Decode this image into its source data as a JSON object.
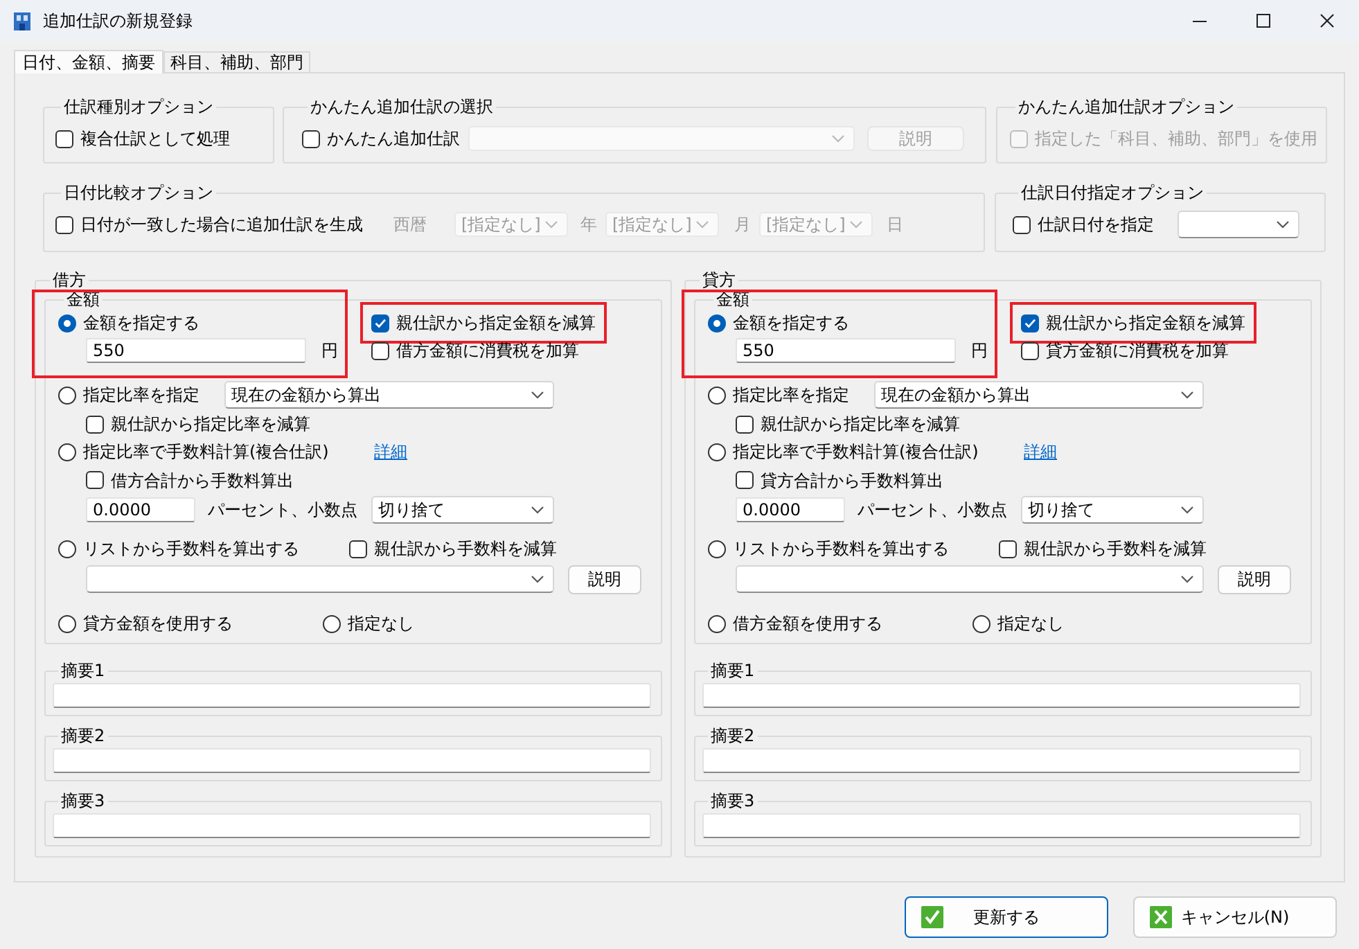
{
  "window": {
    "title": "追加仕訳の新規登録"
  },
  "tabs": [
    {
      "label": "日付、金額、摘要",
      "selected": true
    },
    {
      "label": "科目、補助、部門",
      "selected": false
    }
  ],
  "entry_type_option": {
    "title": "仕訳種別オプション",
    "compound": {
      "label": "複合仕訳として処理",
      "checked": false
    }
  },
  "simple_entry_selection": {
    "title": "かんたん追加仕訳の選択",
    "enable": {
      "label": "かんたん追加仕訳",
      "checked": false
    },
    "dropdown": {
      "disabled": true
    },
    "button": {
      "label": "説明",
      "disabled": true
    }
  },
  "simple_entry_option": {
    "title": "かんたん追加仕訳オプション",
    "use_accounts": {
      "label": "指定した「科目、補助、部門」を使用",
      "checked": false,
      "disabled": true
    }
  },
  "date_compare_option": {
    "title": "日付比較オプション",
    "generate": {
      "label": "日付が一致した場合に追加仕訳を生成",
      "checked": false
    },
    "fields": [
      {
        "kind": "label",
        "text": "西暦",
        "disabled": true
      },
      {
        "kind": "select",
        "value": "[指定なし]",
        "disabled": true
      },
      {
        "kind": "label",
        "text": "年",
        "disabled": true
      },
      {
        "kind": "select",
        "value": "[指定なし]",
        "disabled": true
      },
      {
        "kind": "label",
        "text": "月",
        "disabled": true
      },
      {
        "kind": "select",
        "value": "[指定なし]",
        "disabled": true
      },
      {
        "kind": "label",
        "text": "日",
        "disabled": true
      }
    ]
  },
  "entry_date_option": {
    "title": "仕訳日付指定オプション",
    "specify": {
      "label": "仕訳日付を指定",
      "checked": false
    },
    "dropdown": {
      "disabled": false
    }
  },
  "panels": [
    {
      "title": "借方",
      "amount": {
        "label": "金額",
        "highlighted": true,
        "radio": {
          "label": "金額を指定する",
          "selected": true
        },
        "value": "550",
        "unit": "円"
      },
      "subtract_amount": {
        "label": "親仕訳から指定金額を減算",
        "checked": true,
        "highlighted": true
      },
      "add_tax": {
        "label": "借方金額に消費税を加算",
        "checked": false
      },
      "ratio": {
        "radio": {
          "label": "指定比率を指定",
          "selected": false
        },
        "dropdown": "現在の金額から算出",
        "subtract": {
          "label": "親仕訳から指定比率を減算",
          "checked": false
        }
      },
      "fee": {
        "radio": {
          "label": "指定比率で手数料計算(複合仕訳)",
          "selected": false
        },
        "link": "詳細",
        "total": {
          "label": "借方合計から手数料算出",
          "checked": false
        },
        "percent": "0.0000",
        "percent_label": "パーセント、小数点",
        "rounding": "切り捨て"
      },
      "list": {
        "radio": {
          "label": "リストから手数料を算出する",
          "selected": false
        },
        "subtract": {
          "label": "親仕訳から手数料を減算",
          "checked": false
        },
        "button": "説明"
      },
      "use_other": {
        "label": "貸方金額を使用する",
        "selected": false
      },
      "none": {
        "label": "指定なし",
        "selected": false
      },
      "summaries": [
        {
          "label": "摘要1"
        },
        {
          "label": "摘要2"
        },
        {
          "label": "摘要3"
        }
      ]
    },
    {
      "title": "貸方",
      "amount": {
        "label": "金額",
        "highlighted": true,
        "radio": {
          "label": "金額を指定する",
          "selected": true
        },
        "value": "550",
        "unit": "円"
      },
      "subtract_amount": {
        "label": "親仕訳から指定金額を減算",
        "checked": true,
        "highlighted": true
      },
      "add_tax": {
        "label": "貸方金額に消費税を加算",
        "checked": false
      },
      "ratio": {
        "radio": {
          "label": "指定比率を指定",
          "selected": false
        },
        "dropdown": "現在の金額から算出",
        "subtract": {
          "label": "親仕訳から指定比率を減算",
          "checked": false
        }
      },
      "fee": {
        "radio": {
          "label": "指定比率で手数料計算(複合仕訳)",
          "selected": false
        },
        "link": "詳細",
        "total": {
          "label": "貸方合計から手数料算出",
          "checked": false
        },
        "percent": "0.0000",
        "percent_label": "パーセント、小数点",
        "rounding": "切り捨て"
      },
      "list": {
        "radio": {
          "label": "リストから手数料を算出する",
          "selected": false
        },
        "subtract": {
          "label": "親仕訳から手数料を減算",
          "checked": false
        },
        "button": "説明"
      },
      "use_other": {
        "label": "借方金額を使用する",
        "selected": false
      },
      "none": {
        "label": "指定なし",
        "selected": false
      },
      "summaries": [
        {
          "label": "摘要1"
        },
        {
          "label": "摘要2"
        },
        {
          "label": "摘要3"
        }
      ]
    }
  ],
  "buttons": [
    {
      "label": "更新する",
      "kind": "confirm",
      "default": true
    },
    {
      "label": "キャンセル(N)",
      "kind": "cancel",
      "default": false
    }
  ]
}
